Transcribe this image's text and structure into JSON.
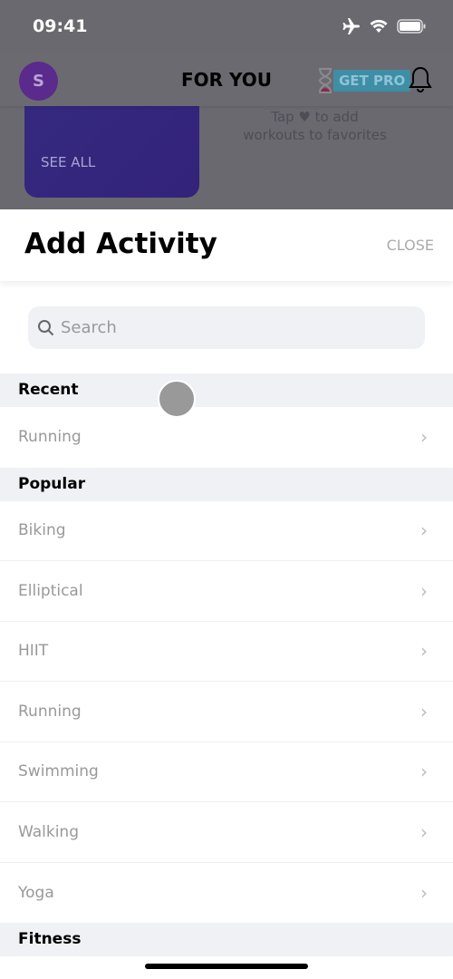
{
  "status": {
    "time": "09:41",
    "icons": [
      "airplane-icon",
      "wifi-icon",
      "battery-icon"
    ]
  },
  "header": {
    "avatar_initial": "S",
    "title": "FOR YOU",
    "pro_label": "GET PRO"
  },
  "background": {
    "see_all": "SEE ALL",
    "tip_line1": "Tap ♥ to add",
    "tip_line2": "workouts to favorites"
  },
  "sheet": {
    "title": "Add Activity",
    "close": "CLOSE",
    "search_placeholder": "Search",
    "sections": [
      {
        "title": "Recent",
        "items": [
          "Running"
        ]
      },
      {
        "title": "Popular",
        "items": [
          "Biking",
          "Elliptical",
          "HIIT",
          "Running",
          "Swimming",
          "Walking",
          "Yoga"
        ]
      },
      {
        "title": "Fitness",
        "items": []
      }
    ]
  },
  "colors": {
    "avatar": "#7b2fbf",
    "pro": "#4cc6ef",
    "card": "#6a4dff"
  }
}
